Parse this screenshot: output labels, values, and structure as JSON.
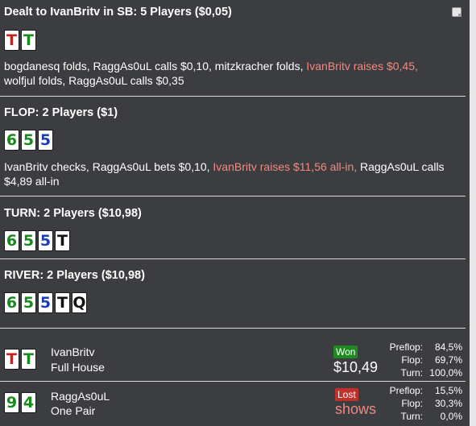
{
  "header": {
    "title": "Dealt to IvanBritv in SB: 5 Players ($0,05)"
  },
  "preflop": {
    "hole_cards": [
      {
        "rank": "T",
        "color": "#c8211e"
      },
      {
        "rank": "T",
        "color": "#188a1e"
      }
    ],
    "actions": {
      "line1_normal": "bogdanesq folds, RaggAs0uL calls $0,10, mitzkracher folds, ",
      "line1_hl": "IvanBritv raises $0,45,",
      "line2_normal": "wolfjul folds, RaggAs0uL calls $0,35"
    }
  },
  "flop": {
    "title": "FLOP: 2 Players ($1)",
    "cards": [
      {
        "rank": "6",
        "color": "#188a1e"
      },
      {
        "rank": "5",
        "color": "#188a1e"
      },
      {
        "rank": "5",
        "color": "#1c3fb0"
      }
    ],
    "actions": {
      "normal1": "IvanBritv checks, RaggAs0uL bets $0,10, ",
      "hl": "IvanBritv raises $11,56 all-in,",
      "normal2": " RaggAs0uL calls",
      "line2": "$4,89 all-in"
    }
  },
  "turn": {
    "title": "TURN: 2 Players ($10,98)",
    "cards": [
      {
        "rank": "6",
        "color": "#188a1e"
      },
      {
        "rank": "5",
        "color": "#188a1e"
      },
      {
        "rank": "5",
        "color": "#1c3fb0"
      },
      {
        "rank": "T",
        "color": "#111111"
      }
    ]
  },
  "river": {
    "title": "RIVER: 2 Players ($10,98)",
    "cards": [
      {
        "rank": "6",
        "color": "#188a1e"
      },
      {
        "rank": "5",
        "color": "#188a1e"
      },
      {
        "rank": "5",
        "color": "#1c3fb0"
      },
      {
        "rank": "T",
        "color": "#111111"
      },
      {
        "rank": "Q",
        "color": "#111111"
      }
    ]
  },
  "players": [
    {
      "name": "IvanBritv",
      "hand": "Full House",
      "cards": [
        {
          "rank": "T",
          "color": "#c8211e"
        },
        {
          "rank": "T",
          "color": "#188a1e"
        }
      ],
      "result_badge": "Won",
      "result_value": "$10,49",
      "stats": {
        "preflop_label": "Preflop:",
        "preflop": "84,5%",
        "flop_label": "Flop:",
        "flop": "69,7%",
        "turn_label": "Turn:",
        "turn": "100,0%"
      }
    },
    {
      "name": "RaggAs0uL",
      "hand": "One Pair",
      "cards": [
        {
          "rank": "9",
          "color": "#188a1e"
        },
        {
          "rank": "4",
          "color": "#188a1e"
        }
      ],
      "result_badge": "Lost",
      "result_value": "shows",
      "stats": {
        "preflop_label": "Preflop:",
        "preflop": "15,5%",
        "flop_label": "Flop:",
        "flop": "30,3%",
        "turn_label": "Turn:",
        "turn": "0,0%"
      }
    }
  ],
  "colors": {
    "background": "#3c3d40",
    "highlight": "#f08a80",
    "won": "#1f8a1f",
    "lost": "#c0312b"
  }
}
